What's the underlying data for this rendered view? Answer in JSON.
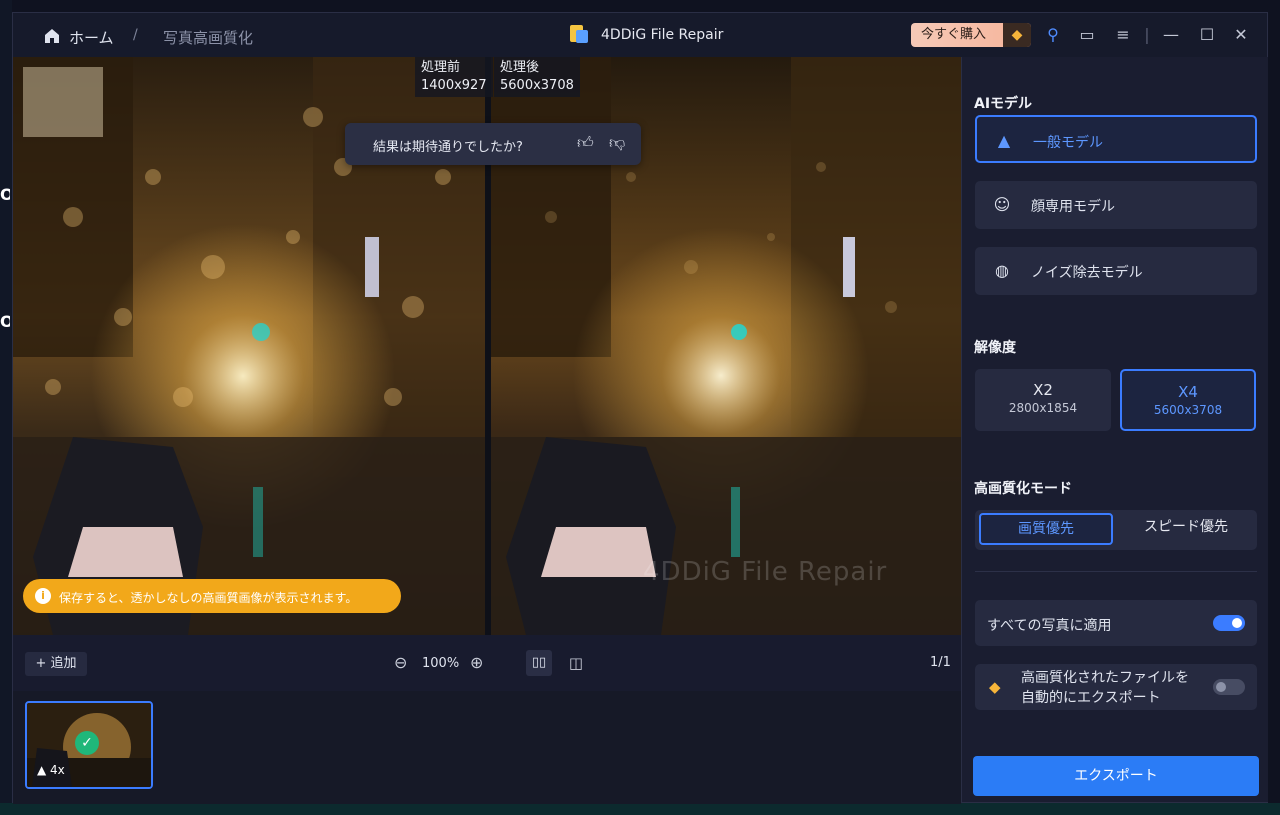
{
  "breadcrumb": {
    "home": "ホーム",
    "separator": "/",
    "current": "写真高画質化"
  },
  "app": {
    "title": "4DDiG File Repair",
    "buy_label": "今すぐ購入"
  },
  "viewer": {
    "before_label": "処理前",
    "before_size": "1400x927",
    "after_label": "処理後",
    "after_size": "5600x3708",
    "feedback_text": "結果は期待通りでしたか?",
    "notice_text": "保存すると、透かしなしの高画質画像が表示されます。",
    "watermark": "4DDiG File Repair"
  },
  "toolbar": {
    "add_label": "追加",
    "zoom": "100%",
    "page": "1/1"
  },
  "thumbnail": {
    "scale": "4x"
  },
  "panel": {
    "ai_model_title": "AIモデル",
    "models": [
      {
        "label": "一般モデル",
        "icon": "landscape-icon",
        "active": true
      },
      {
        "label": "顔専用モデル",
        "icon": "face-icon",
        "active": false
      },
      {
        "label": "ノイズ除去モデル",
        "icon": "noise-icon",
        "active": false
      }
    ],
    "resolution_title": "解像度",
    "resolutions": [
      {
        "label": "X2",
        "size": "2800x1854",
        "active": false
      },
      {
        "label": "X4",
        "size": "5600x3708",
        "active": true
      }
    ],
    "mode_title": "高画質化モード",
    "modes": [
      {
        "label": "画質優先",
        "active": true
      },
      {
        "label": "スピード優先",
        "active": false
      }
    ],
    "apply_all_label": "すべての写真に適用",
    "apply_all_on": true,
    "auto_export_line1": "高画質化されたファイルを",
    "auto_export_line2": "自動的にエクスポート",
    "auto_export_on": false,
    "export_label": "エクスポート"
  },
  "colors": {
    "accent": "#3b7cff",
    "notice": "#f2a81a",
    "export": "#2b7cf6",
    "success": "#1fb77a"
  }
}
